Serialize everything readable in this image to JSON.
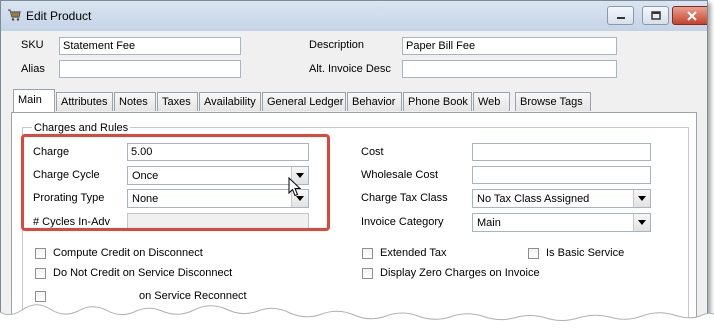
{
  "window": {
    "title": "Edit Product",
    "controls": {
      "minimize": "—",
      "maximize": "□",
      "close": "✕"
    }
  },
  "header": {
    "sku_label": "SKU",
    "sku_value": "Statement Fee",
    "alias_label": "Alias",
    "alias_value": "",
    "description_label": "Description",
    "description_value": "Paper Bill Fee",
    "alt_invoice_label": "Alt. Invoice Desc",
    "alt_invoice_value": ""
  },
  "tabs": [
    "Main",
    "Attributes",
    "Notes",
    "Taxes",
    "Availability",
    "General Ledger",
    "Behavior",
    "Phone Book",
    "Web",
    "Browse Tags"
  ],
  "active_tab": "Main",
  "main": {
    "group_title": "Charges and Rules",
    "charge_label": "Charge",
    "charge_value": "5.00",
    "charge_cycle_label": "Charge Cycle",
    "charge_cycle_value": "Once",
    "prorating_type_label": "Prorating Type",
    "prorating_type_value": "None",
    "cycles_in_adv_label": "# Cycles In-Adv",
    "cycles_in_adv_value": "",
    "cost_label": "Cost",
    "cost_value": "",
    "wholesale_cost_label": "Wholesale Cost",
    "wholesale_cost_value": "",
    "charge_tax_class_label": "Charge Tax Class",
    "charge_tax_class_value": "No Tax Class Assigned",
    "invoice_category_label": "Invoice Category",
    "invoice_category_value": "Main",
    "checkboxes": {
      "compute_credit": "Compute Credit on Disconnect",
      "do_not_credit": "Do Not Credit on Service Disconnect",
      "service_reconnect": "on Service Reconnect",
      "extended_tax": "Extended Tax",
      "is_basic_service": "Is Basic Service",
      "display_zero": "Display Zero Charges on Invoice"
    }
  },
  "colors": {
    "highlight": "#e0473b",
    "titlebar": "#c9d8ea",
    "close_button": "#c6412b"
  },
  "icons": [
    "app-icon",
    "minimize-icon",
    "maximize-icon",
    "close-icon",
    "dropdown-arrow-icon",
    "mouse-cursor-icon"
  ]
}
